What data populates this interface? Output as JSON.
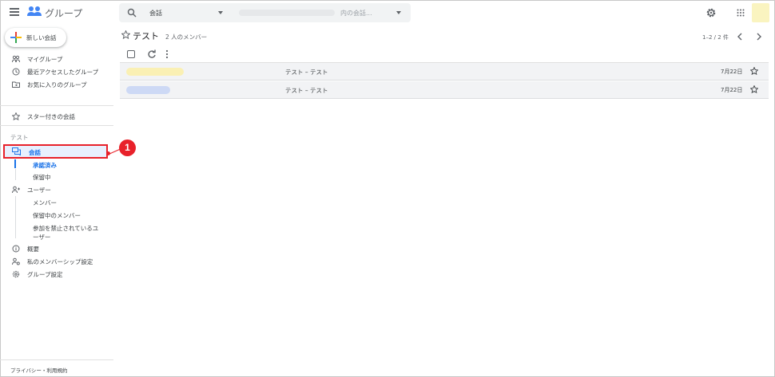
{
  "header": {
    "app_title": "グループ",
    "search_scope": "会話",
    "search_placeholder": "内の会話..."
  },
  "sidebar": {
    "new_conversation": "新しい会話",
    "top_items": [
      {
        "label": "マイグループ",
        "icon": "my-groups-icon"
      },
      {
        "label": "最近アクセスしたグループ",
        "icon": "clock-icon"
      },
      {
        "label": "お気に入りのグループ",
        "icon": "folder-star-icon"
      }
    ],
    "starred": "スター付きの会話",
    "group_section": "テスト",
    "conversations": "会話",
    "conversations_sub": [
      "承認済み",
      "保留中"
    ],
    "users": "ユーザー",
    "users_sub": [
      "メンバー",
      "保留中のメンバー",
      "参加を禁止されているユ",
      "ーザー"
    ],
    "about": "概要",
    "membership": "私のメンバーシップ設定",
    "group_settings": "グループ設定",
    "footer": "プライバシー・利用規約"
  },
  "callout": {
    "number": "1"
  },
  "main": {
    "group_title": "テスト",
    "member_count": "2 人のメンバー",
    "pagination": "1–2 / 2 件",
    "conversations": [
      {
        "subject": "テスト – テスト",
        "date": "7月22日",
        "sender_color": "#faf0b4"
      },
      {
        "subject": "テスト – テスト",
        "date": "7月22日",
        "sender_color": "#cdd9f5"
      }
    ]
  },
  "colors": {
    "accent": "#1a73e8",
    "callout": "#e8212a"
  }
}
